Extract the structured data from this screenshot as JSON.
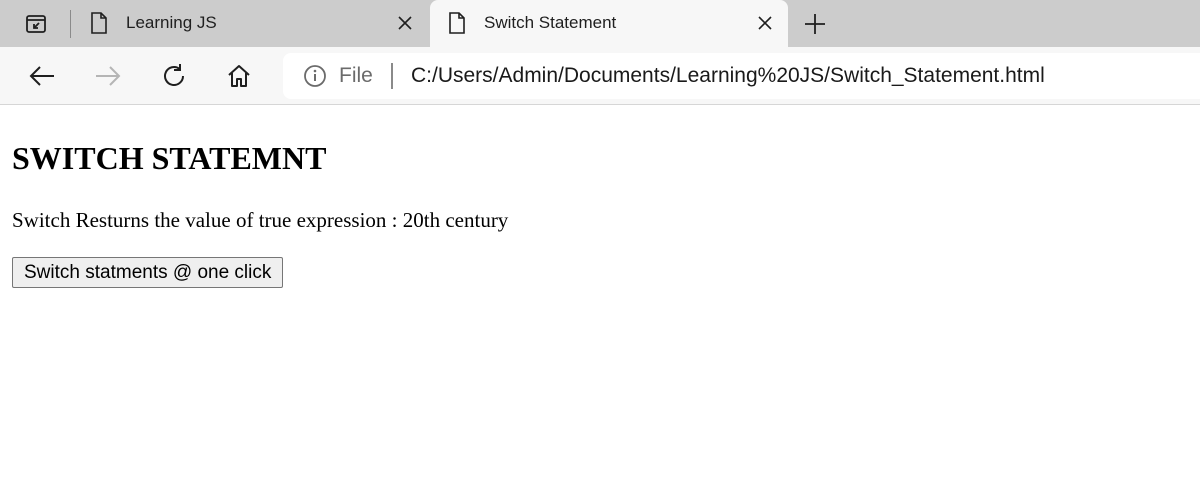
{
  "browser": {
    "tabs": [
      {
        "title": "Learning JS",
        "active": false,
        "icon": "page-icon"
      },
      {
        "title": "Switch Statement",
        "active": true,
        "icon": "page-icon"
      }
    ],
    "address_bar": {
      "scheme_label": "File",
      "url": "C:/Users/Admin/Documents/Learning%20JS/Switch_Statement.html"
    }
  },
  "page": {
    "heading": "SWITCH STATEMNT",
    "result_text": "Switch Resturns the value of true expression : 20th century",
    "button_label": "Switch statments @ one click"
  },
  "colors": {
    "tabstrip_bg": "#cccccc",
    "active_tab_bg": "#f7f7f7",
    "toolbar_bg": "#f7f7f7"
  }
}
